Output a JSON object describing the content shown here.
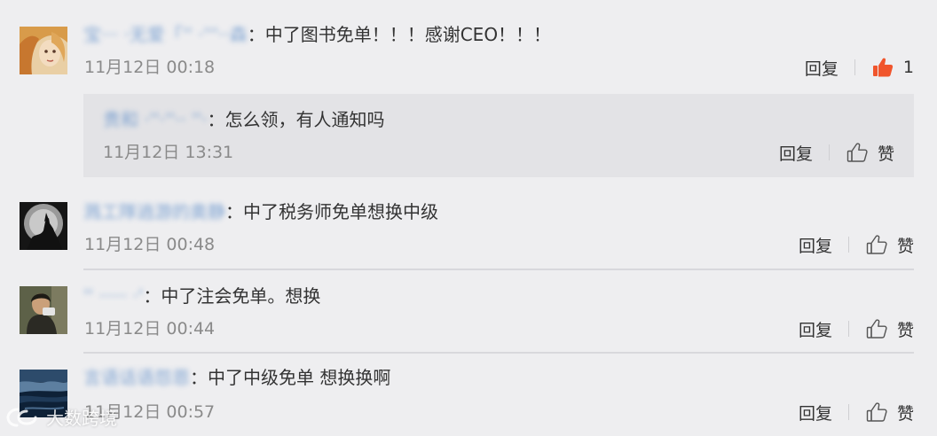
{
  "comments": [
    {
      "username": "宝··· ·无爱「'' ·'''··森",
      "separator": "：",
      "text": "中了图书免单！！！感谢CEO！！！",
      "time": "11月12日 00:18",
      "reply_label": "回复",
      "like_label": "1",
      "like_active": true,
      "reply": {
        "username": "贵和 ·''·''·· ''·",
        "separator": "：",
        "text": "怎么领，有人通知吗",
        "time": "11月12日 13:31",
        "reply_label": "回复",
        "like_label": "赞"
      }
    },
    {
      "username": "溅工隊逍游的奥静",
      "separator": "：",
      "text": "中了税务师免单想换中级",
      "time": "11月12日 00:48",
      "reply_label": "回复",
      "like_label": "赞"
    },
    {
      "username": "'' ····· ·'",
      "separator": "：",
      "text": "中了注会免单。想换",
      "time": "11月12日 00:44",
      "reply_label": "回复",
      "like_label": "赞"
    },
    {
      "username": "言语话语怨恩",
      "separator": "：",
      "text": "中了中级免单 想换换啊",
      "time": "11月12日 00:57",
      "reply_label": "回复",
      "like_label": "赞"
    }
  ],
  "watermark": {
    "text": "大数跨境",
    "icon": "logo-icon"
  },
  "colors": {
    "background": "#eeeef0",
    "reply_box": "#e3e3e6",
    "username": "#5b8cc9",
    "time": "#8a8a8a",
    "like_active": "#f0552c"
  }
}
